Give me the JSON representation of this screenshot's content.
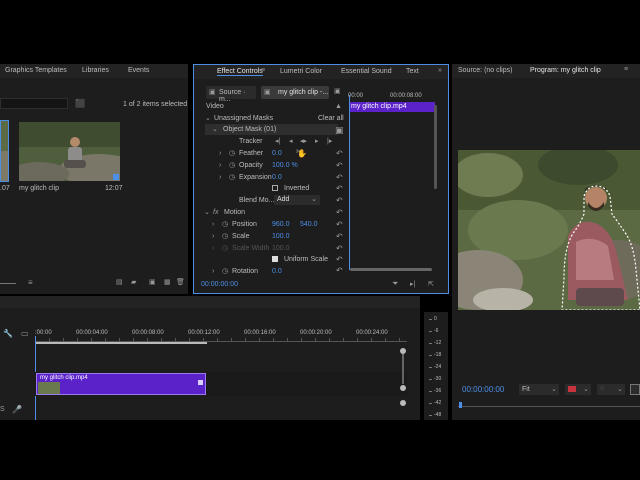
{
  "project_panel": {
    "tabs": [
      "Graphics Templates",
      "Libraries",
      "Events"
    ],
    "items_count": "1 of 2 items selected",
    "items": [
      {
        "name": "",
        "duration": ".07"
      },
      {
        "name": "my glitch clip",
        "duration": "12:07"
      }
    ]
  },
  "effect_controls": {
    "tabs": [
      "Effect Controls",
      "Lumetri Color",
      "Essential Sound",
      "Text"
    ],
    "source_tab": "Source · m...",
    "clip_tab": "my glitch clip -...",
    "mini_timecode": "00:00",
    "mini_timecode2": "00:00:08:00",
    "mini_clip_label": "my glitch clip.mp4",
    "video_label": "Video",
    "unassigned_masks": "Unassigned Masks",
    "clear_all": "Clear all",
    "object_mask": "Object Mask (01)",
    "tracker": "Tracker",
    "feather_label": "Feather",
    "feather_value": "0.0",
    "opacity_label": "Opacity",
    "opacity_value": "100.0 %",
    "expansion_label": "Expansion",
    "expansion_value": "0.0",
    "inverted_label": "Inverted",
    "blend_label": "Blend Mo...",
    "blend_value": "Add",
    "motion_label": "Motion",
    "fx_label": "fx",
    "position_label": "Position",
    "position_x": "960.0",
    "position_y": "540.0",
    "scale_label": "Scale",
    "scale_value": "100.0",
    "scale_width_label": "Scale Width",
    "scale_width_value": "100.0",
    "uniform_scale_label": "Uniform Scale",
    "rotation_label": "Rotation",
    "rotation_value": "0.0",
    "timecode": "00:00:00:00"
  },
  "program_monitor": {
    "source_tab": "Source: (no clips)",
    "program_tab": "Program: my glitch clip",
    "timecode": "00:00:00:00",
    "fit": "Fit"
  },
  "timeline": {
    "ruler": [
      ":00:00",
      "00:00:04:00",
      "00:00:08:00",
      "00:00:12:00",
      "00:00:16:00",
      "00:00:20:00",
      "00:00:24:00"
    ],
    "clip_label": "my glitch clip.mp4",
    "meter_scale": [
      "0",
      "-6",
      "-12",
      "-18",
      "-24",
      "-30",
      "-36",
      "-42",
      "-48"
    ]
  },
  "colors": {
    "accent_blue": "#4d8fe6",
    "clip_purple": "#5a22c8",
    "panel_bg": "#1d1d1d"
  }
}
